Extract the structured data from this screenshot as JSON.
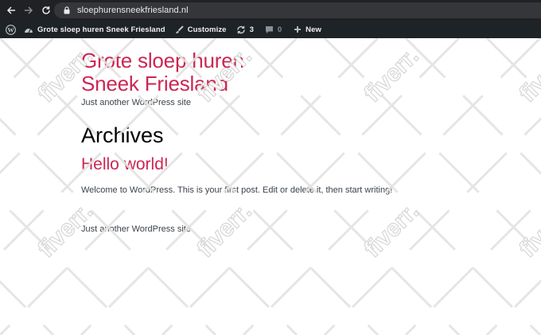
{
  "browser": {
    "url": "sloephurensneekfriesland.nl"
  },
  "admin_bar": {
    "site_name": "Grote sloep huren Sneek Friesland",
    "customize_label": "Customize",
    "updates_count": "3",
    "comments_count": "0",
    "new_label": "New",
    "icons": [
      "wordpress-logo-icon",
      "dashboard-icon",
      "paintbrush-icon",
      "updates-icon",
      "comment-icon",
      "plus-icon"
    ]
  },
  "site": {
    "title": "Grote sloep huren Sneek Friesland",
    "tagline": "Just another WordPress site"
  },
  "main": {
    "archive_title": "Archives",
    "posts": [
      {
        "title": "Hello world!",
        "excerpt": "Welcome to WordPress. This is your first post. Edit or delete it, then start writing!"
      }
    ]
  },
  "footer": {
    "tagline": "Just another WordPress site"
  },
  "watermark": {
    "text": "fiverr."
  },
  "colors": {
    "accent": "#cd2653",
    "admin_bar": "#1d2327",
    "browser_bar": "#202124"
  }
}
